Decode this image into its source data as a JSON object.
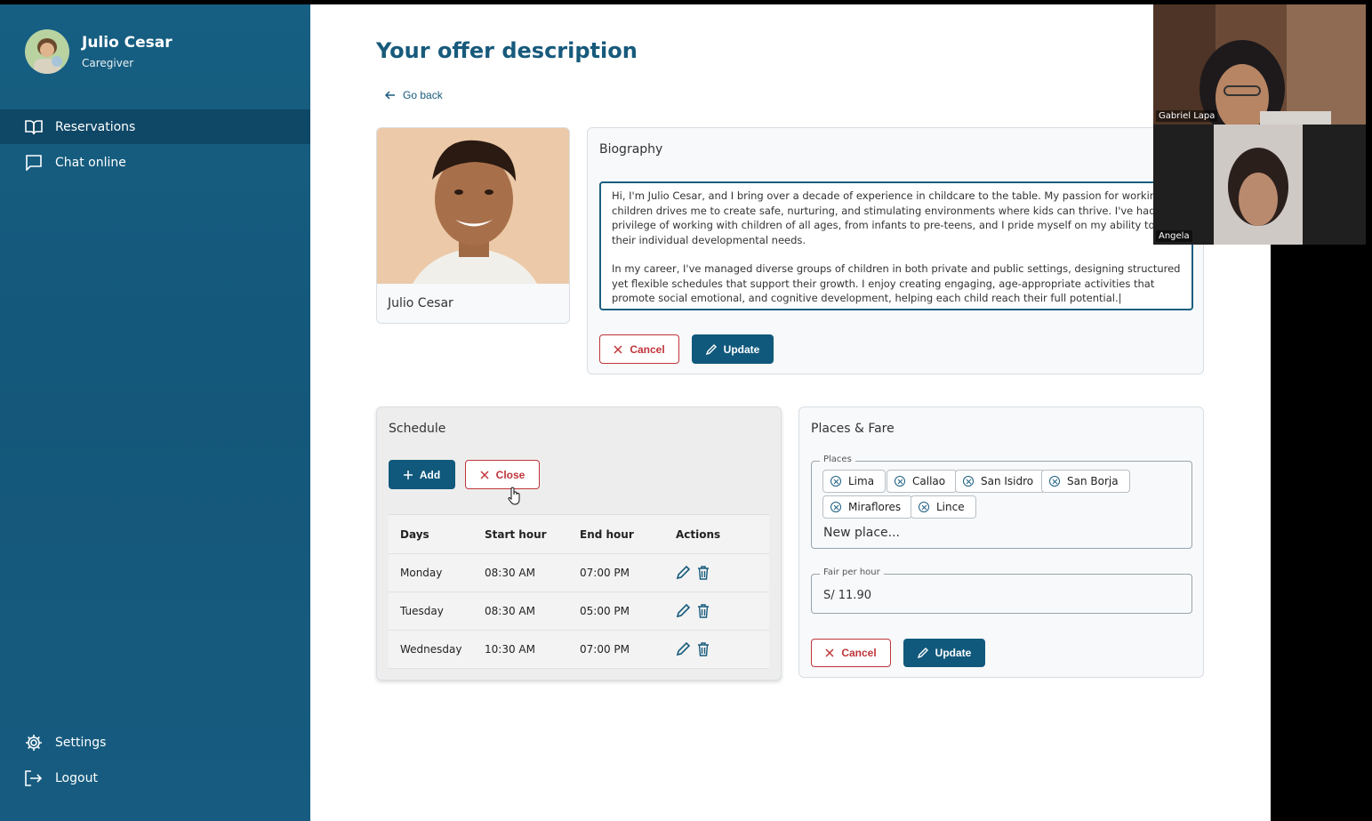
{
  "sidebar": {
    "user_name": "Julio Cesar",
    "user_role": "Caregiver",
    "nav": {
      "reservations": "Reservations",
      "chat": "Chat online",
      "settings": "Settings",
      "logout": "Logout"
    }
  },
  "main": {
    "title": "Your offer description",
    "go_back": "Go back",
    "photo_name": "Julio Cesar",
    "biography": {
      "title": "Biography",
      "paragraph1": "Hi, I'm Julio Cesar, and I bring over a decade of experience in childcare to the table. My passion for working wi children drives me to create safe, nurturing, and stimulating environments where kids can thrive. I've had the privilege of working with children of all ages, from infants to pre-teens, and I pride myself on my ability to cat their individual developmental needs.",
      "paragraph2": "In my career, I've managed diverse groups of children in both private and public settings, designing structured yet flexible schedules that support their growth. I enjoy creating engaging, age-appropriate activities that promote social emotional, and cognitive development, helping each child reach their full potential.|",
      "cancel": "Cancel",
      "update": "Update"
    },
    "schedule": {
      "title": "Schedule",
      "add": "Add",
      "close": "Close",
      "headers": [
        "Days",
        "Start hour",
        "End hour",
        "Actions"
      ],
      "rows": [
        {
          "day": "Monday",
          "start": "08:30 AM",
          "end": "07:00 PM"
        },
        {
          "day": "Tuesday",
          "start": "08:30 AM",
          "end": "05:00 PM"
        },
        {
          "day": "Wednesday",
          "start": "10:30 AM",
          "end": "07:00 PM"
        }
      ]
    },
    "places": {
      "title": "Places & Fare",
      "places_legend": "Places",
      "chips": [
        "Lima",
        "Callao",
        "San Isidro",
        "San Borja",
        "Miraflores",
        "Lince"
      ],
      "new_place_placeholder": "New place...",
      "fare_legend": "Fair per hour",
      "fare_value": "S/ 11.90",
      "cancel": "Cancel",
      "update": "Update"
    }
  },
  "video": {
    "participant1": "Gabriel Lapa",
    "participant2": "Angela"
  },
  "colors": {
    "primary": "#11597c",
    "danger": "#c0353a",
    "sidebar": "#165f82"
  }
}
